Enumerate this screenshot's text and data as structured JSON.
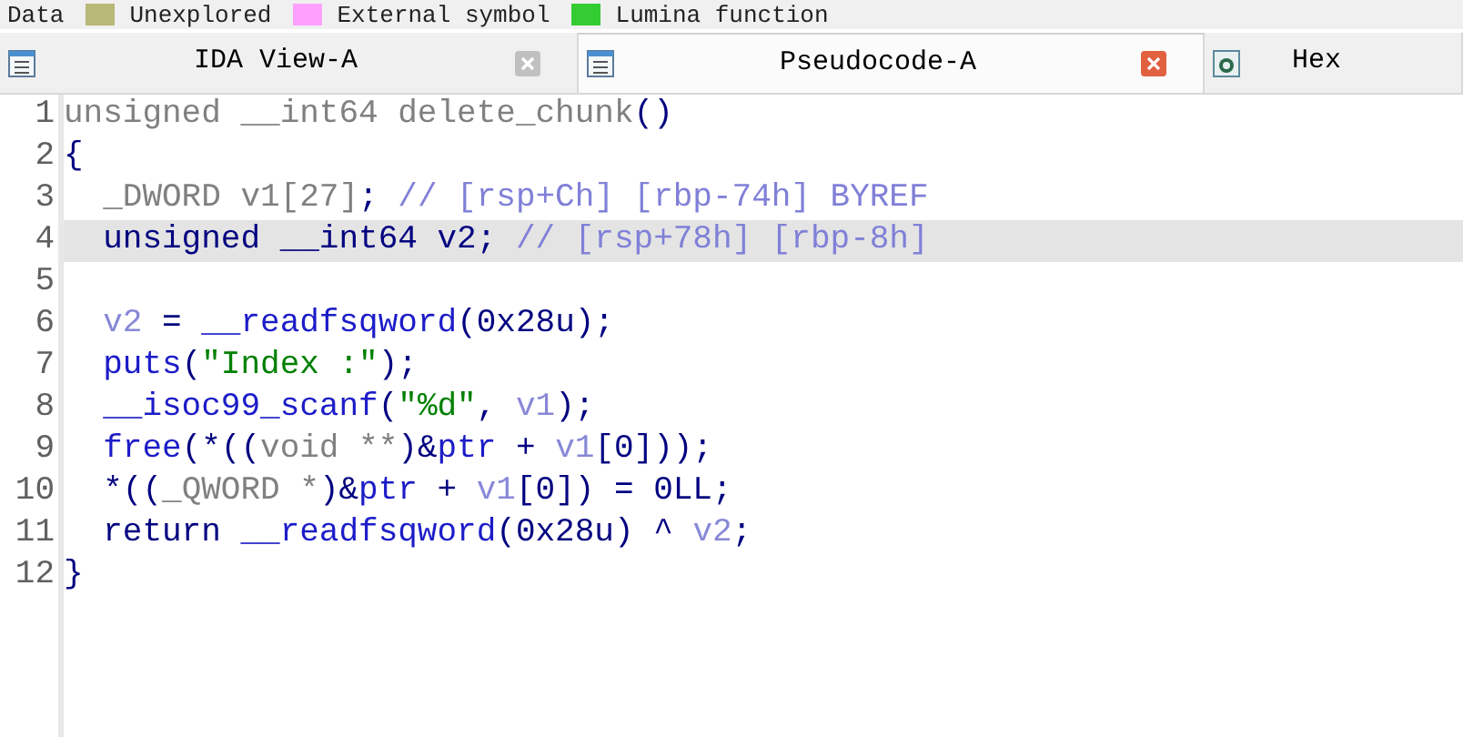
{
  "legend": [
    {
      "label": "Data"
    },
    {
      "label": "Unexplored",
      "color": "#b8b878"
    },
    {
      "label": "External symbol",
      "color": "#ffa0ff"
    },
    {
      "label": "Lumina function",
      "color": "#33cc33"
    }
  ],
  "tabs": [
    {
      "label": "IDA View-A",
      "selected": false,
      "kind": "disasm"
    },
    {
      "label": "Pseudocode-A",
      "selected": true,
      "kind": "pseudo"
    },
    {
      "label": "Hex",
      "selected": false,
      "kind": "hex"
    }
  ],
  "code": [
    {
      "number": "1",
      "highlighted": false,
      "tokens": [
        {
          "text": "unsigned __int64 delete_chunk",
          "kind": "type"
        },
        {
          "text": "()",
          "kind": "punct"
        }
      ]
    },
    {
      "number": "2",
      "highlighted": false,
      "tokens": [
        {
          "text": "{",
          "kind": "punct"
        }
      ]
    },
    {
      "number": "3",
      "highlighted": false,
      "tokens": [
        {
          "text": "  _DWORD v1[27]",
          "kind": "type"
        },
        {
          "text": "; ",
          "kind": "punct"
        },
        {
          "text": "// [rsp+Ch] [rbp-74h] BYREF",
          "kind": "comment"
        }
      ]
    },
    {
      "number": "4",
      "highlighted": true,
      "tokens": [
        {
          "text": "  unsigned __int64 v2; ",
          "kind": "punct"
        },
        {
          "text": "// [rsp+78h] [rbp-8h]",
          "kind": "comment"
        }
      ]
    },
    {
      "number": "5",
      "highlighted": false
    },
    {
      "number": "6",
      "highlighted": false,
      "tokens": [
        {
          "text": "  v2",
          "kind": "var"
        },
        {
          "text": " = ",
          "kind": "punct"
        },
        {
          "text": "__readfsqword",
          "kind": "func"
        },
        {
          "text": "(0x28u);",
          "kind": "punct"
        }
      ]
    },
    {
      "number": "7",
      "highlighted": false,
      "tokens": [
        {
          "text": "  puts",
          "kind": "func"
        },
        {
          "text": "(",
          "kind": "punct"
        },
        {
          "text": "\"Index :\"",
          "kind": "string"
        },
        {
          "text": ");",
          "kind": "punct"
        }
      ]
    },
    {
      "number": "8",
      "highlighted": false,
      "tokens": [
        {
          "text": "  __isoc99_scanf",
          "kind": "func"
        },
        {
          "text": "(",
          "kind": "punct"
        },
        {
          "text": "\"%d\"",
          "kind": "string"
        },
        {
          "text": ", ",
          "kind": "punct"
        },
        {
          "text": "v1",
          "kind": "var"
        },
        {
          "text": ");",
          "kind": "punct"
        }
      ]
    },
    {
      "number": "9",
      "highlighted": false,
      "tokens": [
        {
          "text": "  free",
          "kind": "func"
        },
        {
          "text": "(*((",
          "kind": "punct"
        },
        {
          "text": "void **",
          "kind": "type"
        },
        {
          "text": ")&",
          "kind": "punct"
        },
        {
          "text": "ptr",
          "kind": "func"
        },
        {
          "text": " + ",
          "kind": "punct"
        },
        {
          "text": "v1",
          "kind": "var"
        },
        {
          "text": "[0]));",
          "kind": "punct"
        }
      ]
    },
    {
      "number": "10",
      "highlighted": false,
      "tokens": [
        {
          "text": "  *((",
          "kind": "punct"
        },
        {
          "text": "_QWORD *",
          "kind": "type"
        },
        {
          "text": ")&",
          "kind": "punct"
        },
        {
          "text": "ptr",
          "kind": "func"
        },
        {
          "text": " + ",
          "kind": "punct"
        },
        {
          "text": "v1",
          "kind": "var"
        },
        {
          "text": "[0]) = 0LL;",
          "kind": "punct"
        }
      ]
    },
    {
      "number": "11",
      "highlighted": false,
      "tokens": [
        {
          "text": "  return ",
          "kind": "punct"
        },
        {
          "text": "__readfsqword",
          "kind": "func"
        },
        {
          "text": "(0x28u) ^ ",
          "kind": "punct"
        },
        {
          "text": "v2",
          "kind": "var"
        },
        {
          "text": ";",
          "kind": "punct"
        }
      ]
    },
    {
      "number": "12",
      "highlighted": false,
      "tokens": [
        {
          "text": "}",
          "kind": "punct"
        }
      ]
    }
  ]
}
